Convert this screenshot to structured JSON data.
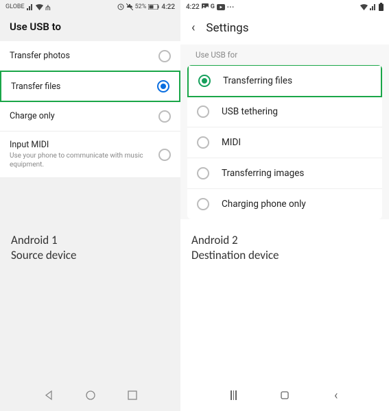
{
  "left": {
    "status": {
      "carrier": "GLOBE",
      "battery": "52%",
      "time": "4:22"
    },
    "title": "Use USB to",
    "options": [
      {
        "label": "Transfer photos",
        "selected": false,
        "sub": ""
      },
      {
        "label": "Transfer files",
        "selected": true,
        "sub": ""
      },
      {
        "label": "Charge only",
        "selected": false,
        "sub": ""
      },
      {
        "label": "Input MIDI",
        "selected": false,
        "sub": "Use your phone to communicate with music equipment."
      }
    ],
    "caption_line1": "Android 1",
    "caption_line2": "Source device"
  },
  "right": {
    "status": {
      "time": "4:22"
    },
    "header": "Settings",
    "section": "Use USB for",
    "options": [
      {
        "label": "Transferring files",
        "selected": true
      },
      {
        "label": "USB tethering",
        "selected": false
      },
      {
        "label": "MIDI",
        "selected": false
      },
      {
        "label": "Transferring images",
        "selected": false
      },
      {
        "label": "Charging phone only",
        "selected": false
      }
    ],
    "caption_line1": "Android 2",
    "caption_line2": "Destination device"
  }
}
